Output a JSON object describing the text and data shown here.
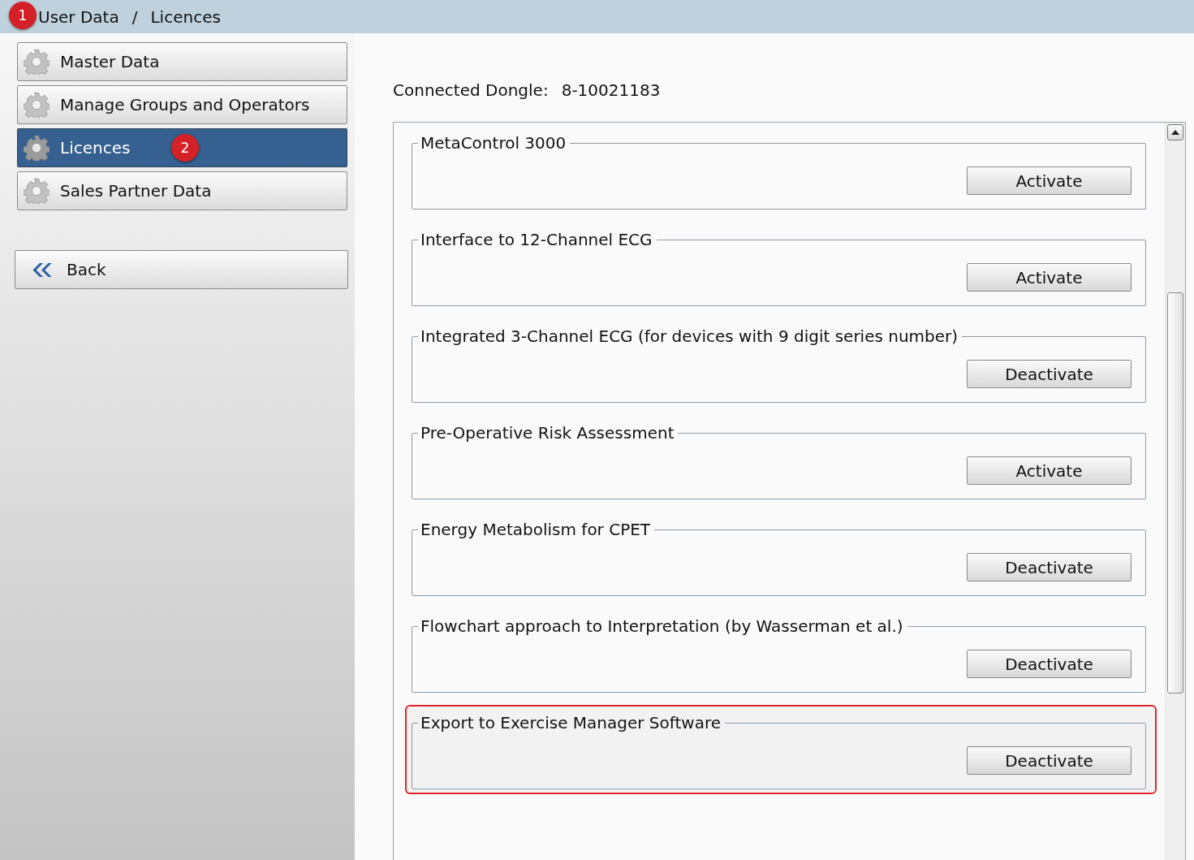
{
  "breadcrumb": {
    "items": [
      "User Data",
      "Licences"
    ],
    "separator": "/",
    "badge": "1"
  },
  "sidebar": {
    "items": [
      {
        "label": "Master Data",
        "selected": false
      },
      {
        "label": "Manage Groups and Operators",
        "selected": false
      },
      {
        "label": "Licences",
        "selected": true,
        "badge": "2"
      },
      {
        "label": "Sales Partner Data",
        "selected": false
      }
    ],
    "back_button": "Back"
  },
  "dongle": {
    "label": "Connected Dongle:",
    "value": "8-10021183"
  },
  "licences": [
    {
      "name": "MetaControl 3000",
      "button": "Activate",
      "highlighted": false
    },
    {
      "name": "Interface to 12-Channel ECG",
      "button": "Activate",
      "highlighted": false
    },
    {
      "name": "Integrated 3-Channel ECG (for devices with 9 digit series number)",
      "button": "Deactivate",
      "highlighted": false
    },
    {
      "name": "Pre-Operative Risk Assessment",
      "button": "Activate",
      "highlighted": false
    },
    {
      "name": "Energy Metabolism for CPET",
      "button": "Deactivate",
      "highlighted": false
    },
    {
      "name": "Flowchart approach to Interpretation (by Wasserman et al.)",
      "button": "Deactivate",
      "highlighted": false
    },
    {
      "name": "Export to Exercise Manager Software",
      "button": "Deactivate",
      "highlighted": true
    }
  ]
}
